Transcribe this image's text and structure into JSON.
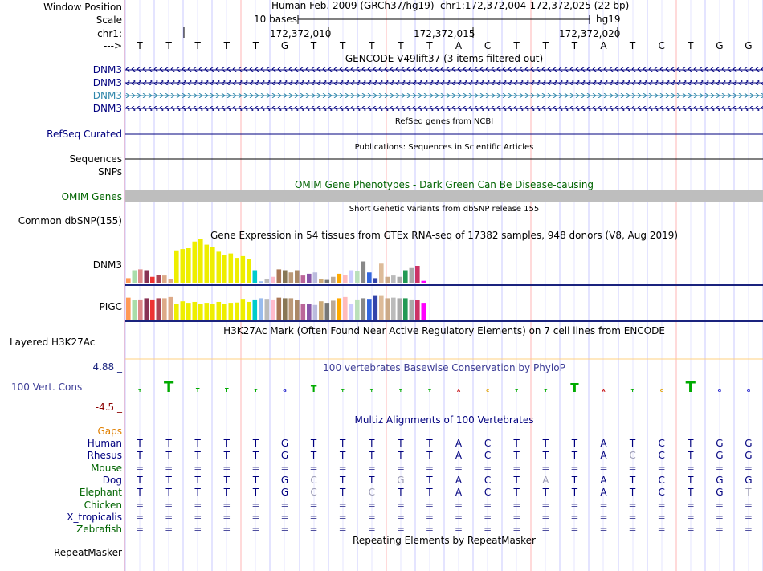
{
  "header": {
    "window_position_label": "Window Position",
    "scale_label": "Scale",
    "chrom_label": "chr1:",
    "arrow_label": "--->",
    "assembly": "Human Feb. 2009 (GRCh37/hg19)",
    "position": "chr1:172,372,004-172,372,025 (22 bp)",
    "scale_text": "10 bases",
    "db": "hg19",
    "ticks": [
      "172,372,010",
      "172,372,015",
      "172,372,020"
    ]
  },
  "sequence": [
    "T",
    "T",
    "T",
    "T",
    "T",
    "G",
    "T",
    "T",
    "T",
    "T",
    "T",
    "A",
    "C",
    "T",
    "T",
    "T",
    "A",
    "T",
    "C",
    "T",
    "G",
    "G"
  ],
  "tracks": {
    "gencode": {
      "title": "GENCODE V49lift37 (3 items filtered out)",
      "items": [
        "DNM3",
        "DNM3",
        "DNM3",
        "DNM3"
      ]
    },
    "refseq": {
      "label": "RefSeq Curated",
      "title": "RefSeq genes from NCBI"
    },
    "publications": {
      "label": "Sequences",
      "title": "Publications: Sequences in Scientific Articles"
    },
    "snps": {
      "label": "SNPs"
    },
    "omim": {
      "label": "OMIM Genes",
      "title": "OMIM Gene Phenotypes - Dark Green Can Be Disease-causing"
    },
    "dbsnp": {
      "label": "Common dbSNP(155)",
      "title": "Short Genetic Variants from dbSNP release 155"
    },
    "gtex": {
      "title": "Gene Expression in 54 tissues from GTEx RNA-seq of 17382 samples, 948 donors (V8, Aug 2019)",
      "genes": [
        "DNM3",
        "PIGC"
      ]
    },
    "h3k27ac": {
      "label": "Layered H3K27Ac",
      "title": "H3K27Ac Mark (Often Found Near Active Regulatory Elements) on 7 cell lines from ENCODE"
    },
    "cons": {
      "label": "100 Vert. Cons",
      "max": "4.88 _",
      "min": "-4.5 _",
      "title": "100 vertebrates Basewise Conservation by PhyloP"
    },
    "multiz": {
      "label": "Gaps",
      "title": "Multiz Alignments of 100 Vertebrates"
    },
    "repeatmasker": {
      "label": "RepeatMasker",
      "title": "Repeating Elements by RepeatMasker"
    }
  },
  "species": [
    {
      "name": "Human",
      "seq": "TTTTTGTTTTTACTTTATCTGG",
      "color": "#00007f"
    },
    {
      "name": "Rhesus",
      "seq": "TTTTTGTTTTTACTTTACCTGG",
      "color": "#00007f"
    },
    {
      "name": "Mouse",
      "seq": "======================",
      "color": "#006400"
    },
    {
      "name": "Dog",
      "seq": "TTTTTGCTTGTACTATATCTGG",
      "color": "#00007f"
    },
    {
      "name": "Elephant",
      "seq": "TTTTTGCTCTTACTTTATCTGT",
      "color": "#006400"
    },
    {
      "name": "Chicken",
      "seq": "======================",
      "color": "#006400"
    },
    {
      "name": "X_tropicalis",
      "seq": "======================",
      "color": "#00007f"
    },
    {
      "name": "Zebrafish",
      "seq": "======================",
      "color": "#006400"
    }
  ],
  "gtex_values": {
    "DNM3": [
      0.12,
      0.3,
      0.32,
      0.3,
      0.15,
      0.2,
      0.18,
      0.1,
      0.75,
      0.78,
      0.8,
      0.95,
      1.0,
      0.88,
      0.82,
      0.72,
      0.65,
      0.68,
      0.58,
      0.62,
      0.55,
      0.3,
      0.05,
      0.1,
      0.15,
      0.32,
      0.3,
      0.25,
      0.3,
      0.18,
      0.22,
      0.25,
      0.1,
      0.08,
      0.15,
      0.22,
      0.2,
      0.3,
      0.28,
      0.5,
      0.25,
      0.12,
      0.45,
      0.15,
      0.18,
      0.15,
      0.3,
      0.35,
      0.4,
      0.06
    ],
    "PIGC": [
      0.72,
      0.64,
      0.66,
      0.7,
      0.66,
      0.7,
      0.7,
      0.74,
      0.5,
      0.6,
      0.55,
      0.58,
      0.5,
      0.55,
      0.52,
      0.58,
      0.5,
      0.55,
      0.56,
      0.68,
      0.58,
      0.66,
      0.7,
      0.68,
      0.66,
      0.72,
      0.7,
      0.7,
      0.65,
      0.5,
      0.5,
      0.48,
      0.6,
      0.55,
      0.62,
      0.7,
      0.74,
      0.5,
      0.66,
      0.7,
      0.68,
      0.8,
      0.8,
      0.7,
      0.72,
      0.7,
      0.7,
      0.66,
      0.64,
      0.55
    ]
  },
  "colors": {
    "label_blue": "#00007f",
    "omim_green": "#006400",
    "gap_orange": "#e07f00",
    "cons_max_blue": "#1a237e",
    "cons_min_red": "#8b0000",
    "cons_title": "#3c3c96",
    "grid_blue": "#c8c8ff",
    "grid_red": "#ffb4b4"
  }
}
